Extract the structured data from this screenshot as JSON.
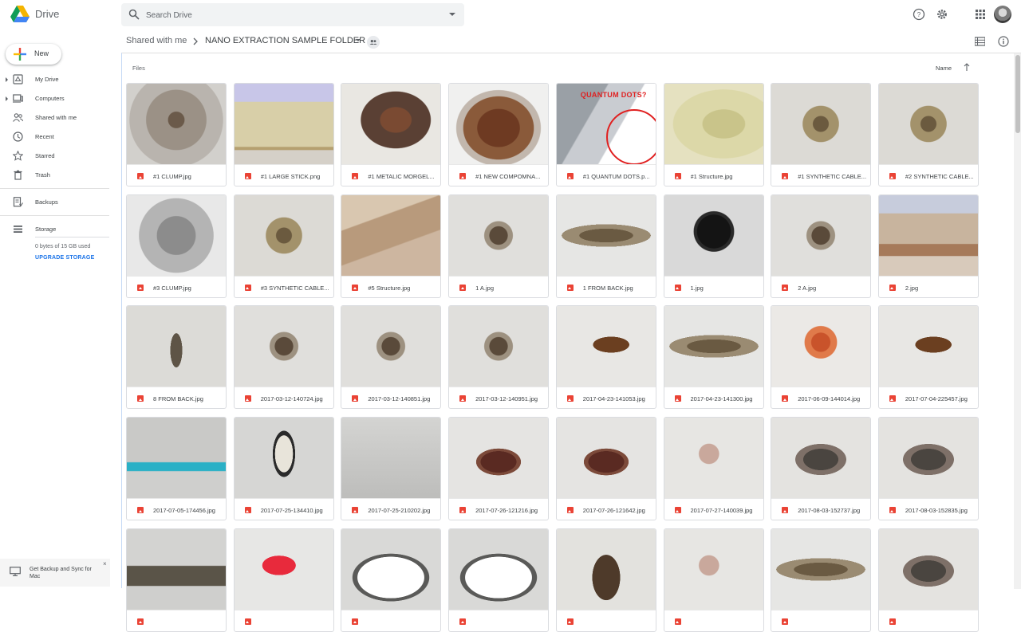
{
  "app": {
    "name": "Drive",
    "brand_colors": [
      "#4285f4",
      "#0f9d58",
      "#f4b400"
    ]
  },
  "search": {
    "placeholder": "Search Drive"
  },
  "header_icons": [
    "help-icon",
    "settings-icon",
    "apps-grid-icon"
  ],
  "new_button": {
    "label": "New"
  },
  "breadcrumb": {
    "parent": "Shared with me",
    "current": "NANO EXTRACTION SAMPLE FOLDER"
  },
  "sidebar": {
    "items": [
      {
        "label": "My Drive",
        "icon": "my-drive-icon",
        "expandable": true
      },
      {
        "label": "Computers",
        "icon": "computers-icon",
        "expandable": true
      },
      {
        "label": "Shared with me",
        "icon": "shared-icon",
        "expandable": false
      },
      {
        "label": "Recent",
        "icon": "recent-icon",
        "expandable": false
      },
      {
        "label": "Starred",
        "icon": "star-icon",
        "expandable": false
      },
      {
        "label": "Trash",
        "icon": "trash-icon",
        "expandable": false
      }
    ],
    "backups": {
      "label": "Backups"
    },
    "storage": {
      "label": "Storage",
      "used": "0 bytes of 15 GB used",
      "upgrade": "UPGRADE STORAGE"
    },
    "promo": {
      "text": "Get Backup and Sync for Mac",
      "close": "×"
    }
  },
  "main": {
    "section_label": "Files",
    "sort_label": "Name",
    "files": [
      {
        "name": "#1 CLUMP.jpg",
        "thumb": "a"
      },
      {
        "name": "#1 LARGE STICK.png",
        "thumb": "b"
      },
      {
        "name": "#1 METALIC MORGEL...",
        "thumb": "c"
      },
      {
        "name": "#1 NEW COMPOMNA...",
        "thumb": "d"
      },
      {
        "name": "#1 QUANTUM DOTS.p...",
        "thumb": "e",
        "overlay": "QUANTUM DOTS?"
      },
      {
        "name": "#1 Structure.jpg",
        "thumb": "f"
      },
      {
        "name": "#1 SYNTHETIC CABLE...",
        "thumb": "g"
      },
      {
        "name": "#2 SYNTHETIC CABLE...",
        "thumb": "g"
      },
      {
        "name": "#3 CLUMP.jpg",
        "thumb": "h"
      },
      {
        "name": "#3 SYNTHETIC CABLE...",
        "thumb": "g"
      },
      {
        "name": "#5 Structure.jpg",
        "thumb": "i"
      },
      {
        "name": "1 A.jpg",
        "thumb": "j"
      },
      {
        "name": "1 FROM BACK.jpg",
        "thumb": "k"
      },
      {
        "name": "1.jpg",
        "thumb": "l"
      },
      {
        "name": "2 A.jpg",
        "thumb": "j"
      },
      {
        "name": "2.jpg",
        "thumb": "m"
      },
      {
        "name": "8 FROM BACK.jpg",
        "thumb": "n"
      },
      {
        "name": "2017-03-12-140724.jpg",
        "thumb": "j"
      },
      {
        "name": "2017-03-12-140851.jpg",
        "thumb": "j"
      },
      {
        "name": "2017-03-12-140951.jpg",
        "thumb": "j"
      },
      {
        "name": "2017-04-23-141053.jpg",
        "thumb": "o"
      },
      {
        "name": "2017-04-23-141300.jpg",
        "thumb": "k"
      },
      {
        "name": "2017-06-09-144014.jpg",
        "thumb": "p"
      },
      {
        "name": "2017-07-04-225457.jpg",
        "thumb": "o"
      },
      {
        "name": "2017-07-05-174456.jpg",
        "thumb": "q"
      },
      {
        "name": "2017-07-25-134410.jpg",
        "thumb": "r"
      },
      {
        "name": "2017-07-25-210202.jpg",
        "thumb": "s"
      },
      {
        "name": "2017-07-26-121216.jpg",
        "thumb": "t"
      },
      {
        "name": "2017-07-26-121642.jpg",
        "thumb": "t"
      },
      {
        "name": "2017-07-27-140039.jpg",
        "thumb": "u"
      },
      {
        "name": "2017-08-03-152737.jpg",
        "thumb": "v"
      },
      {
        "name": "2017-08-03-152835.jpg",
        "thumb": "v"
      },
      {
        "name": "",
        "thumb": "w"
      },
      {
        "name": "",
        "thumb": "x"
      },
      {
        "name": "",
        "thumb": "y"
      },
      {
        "name": "",
        "thumb": "y"
      },
      {
        "name": "",
        "thumb": "z"
      },
      {
        "name": "",
        "thumb": "u"
      },
      {
        "name": "",
        "thumb": "k"
      },
      {
        "name": "",
        "thumb": "v"
      }
    ]
  }
}
